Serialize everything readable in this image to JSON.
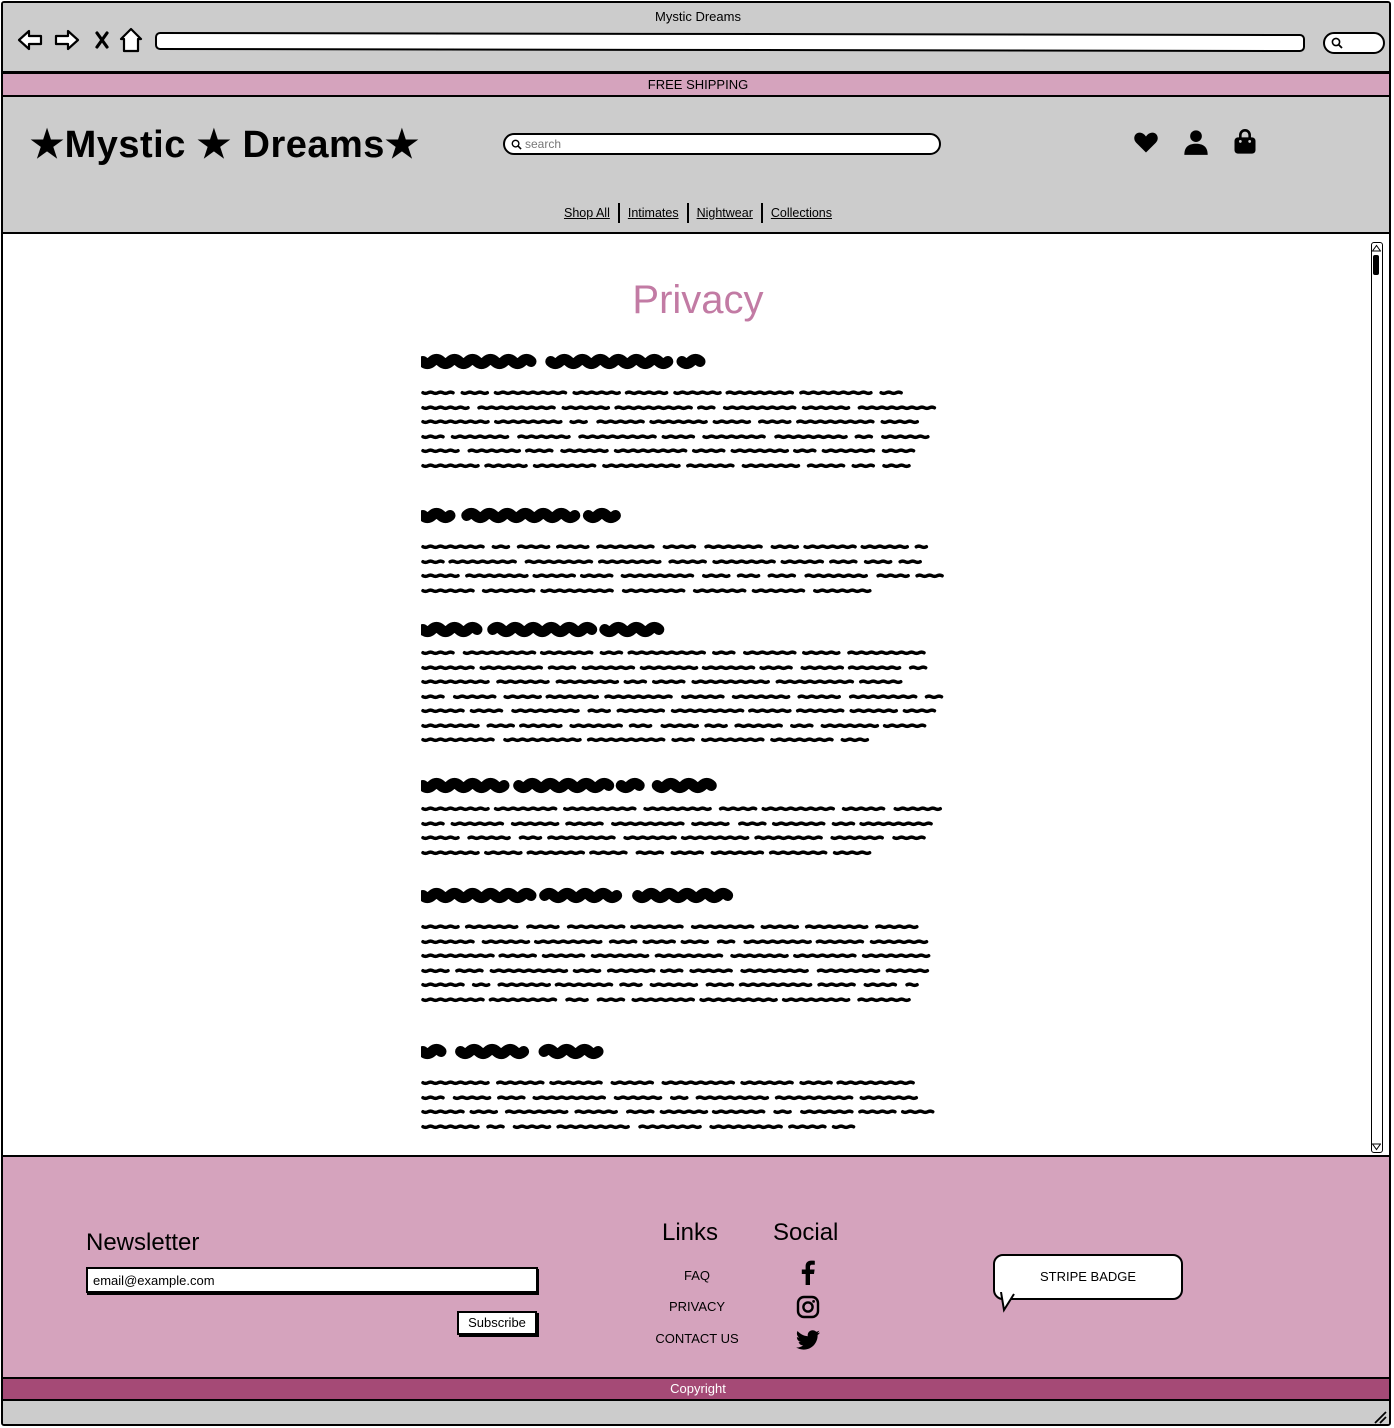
{
  "window": {
    "title": "Mystic Dreams"
  },
  "browser": {
    "back_icon": "back-arrow-icon",
    "forward_icon": "forward-arrow-icon",
    "stop_icon": "close-icon",
    "home_icon": "home-icon",
    "url_value": "",
    "search_icon": "search-icon"
  },
  "promo": {
    "text": "FREE SHIPPING"
  },
  "header": {
    "logo": "★Mystic ★ Dreams★",
    "search_placeholder": "search",
    "icons": [
      "heart-icon",
      "user-icon",
      "shopping-bag-icon"
    ],
    "nav": [
      {
        "label": "Shop All"
      },
      {
        "label": "Intimates"
      },
      {
        "label": "Nightwear"
      },
      {
        "label": "Collections"
      }
    ]
  },
  "main": {
    "title": "Privacy",
    "sections": [
      {
        "heading_lines": 1,
        "body_lines": 6
      },
      {
        "heading_lines": 1,
        "body_lines": 4
      },
      {
        "heading_lines": 1,
        "body_lines": 7
      },
      {
        "heading_lines": 1,
        "body_lines": 4
      },
      {
        "heading_lines": 1,
        "body_lines": 6
      },
      {
        "heading_lines": 1,
        "body_lines": 4
      }
    ]
  },
  "footer": {
    "newsletter": {
      "title": "Newsletter",
      "email_value": "email@example.com",
      "subscribe_label": "Subscribe"
    },
    "links": {
      "title": "Links",
      "items": [
        "FAQ",
        "PRIVACY",
        "CONTACT US"
      ]
    },
    "social": {
      "title": "Social",
      "icons": [
        "facebook-icon",
        "instagram-icon",
        "twitter-icon"
      ]
    },
    "badge": "STRIPE BADGE",
    "copyright": "Copyright"
  },
  "colors": {
    "chrome": "#cccccc",
    "promo": "#d5a3bd",
    "title_accent": "#c27ba4",
    "footer": "#d5a3bd",
    "copyright_bar": "#a54a76"
  }
}
